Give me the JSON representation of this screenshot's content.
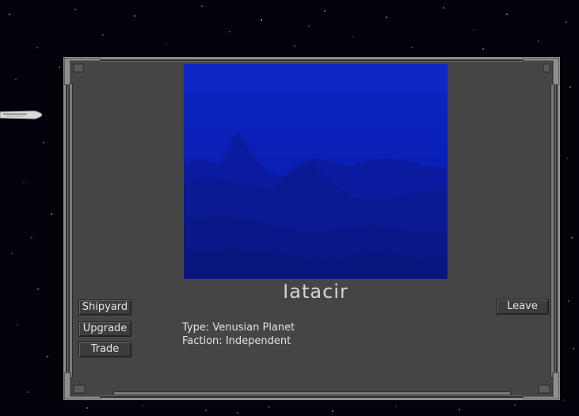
{
  "planet": {
    "name": "Iatacir",
    "type_label": "Type:",
    "type_value": "Venusian Planet",
    "faction_label": "Faction:",
    "faction_value": "Independent"
  },
  "buttons": {
    "shipyard": "Shipyard",
    "upgrade": "Upgrade",
    "trade": "Trade",
    "leave": "Leave"
  },
  "icons": {
    "player_ship": "player-ship-icon"
  },
  "colors": {
    "space": "#02030a",
    "panel": "#454545",
    "planet_sky": "#0a22c8",
    "text": "#e4e4e4"
  }
}
